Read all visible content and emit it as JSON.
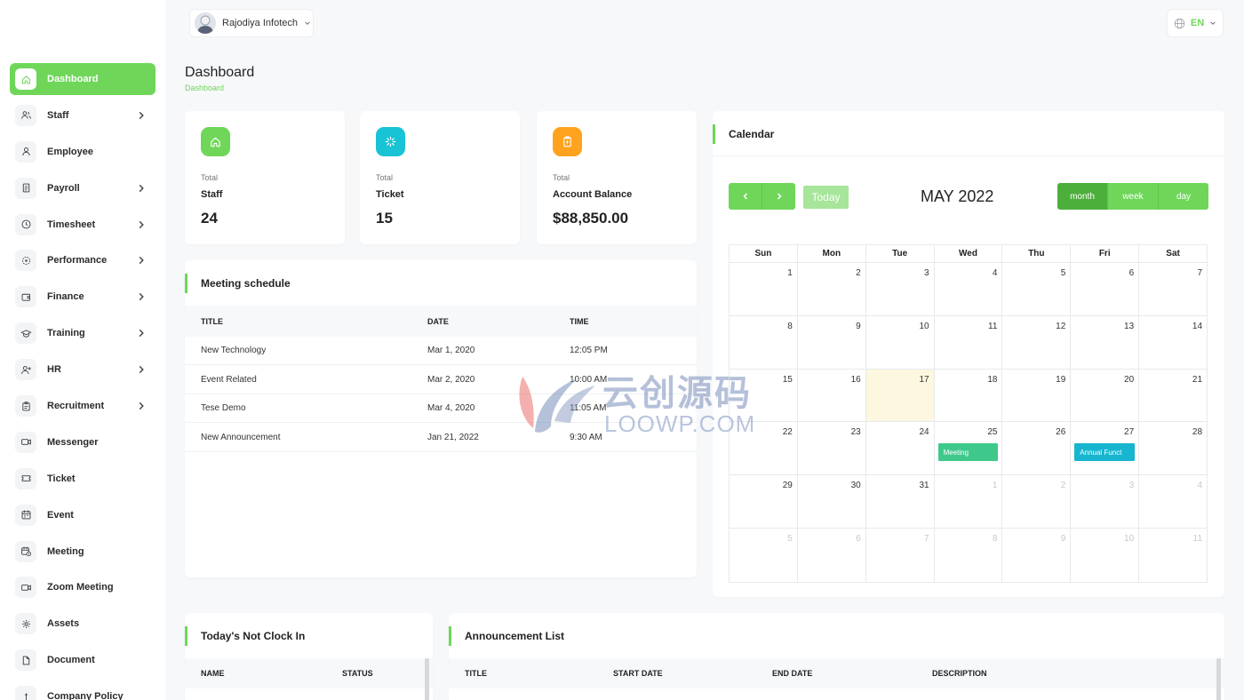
{
  "sidebar": {
    "items": [
      {
        "label": "Dashboard",
        "icon": "home-icon",
        "active": true,
        "chevron": false
      },
      {
        "label": "Staff",
        "icon": "users-icon",
        "chevron": true
      },
      {
        "label": "Employee",
        "icon": "user-icon",
        "chevron": false
      },
      {
        "label": "Payroll",
        "icon": "document-icon",
        "chevron": true
      },
      {
        "label": "Timesheet",
        "icon": "clock-icon",
        "chevron": true
      },
      {
        "label": "Performance",
        "icon": "target-icon",
        "chevron": true
      },
      {
        "label": "Finance",
        "icon": "wallet-icon",
        "chevron": true
      },
      {
        "label": "Training",
        "icon": "graduation-cap-icon",
        "chevron": true
      },
      {
        "label": "HR",
        "icon": "user-plus-icon",
        "chevron": true
      },
      {
        "label": "Recruitment",
        "icon": "clipboard-icon",
        "chevron": true
      },
      {
        "label": "Messenger",
        "icon": "video-icon",
        "chevron": false
      },
      {
        "label": "Ticket",
        "icon": "ticket-icon",
        "chevron": false
      },
      {
        "label": "Event",
        "icon": "calendar-icon",
        "chevron": false
      },
      {
        "label": "Meeting",
        "icon": "calendar-clock-icon",
        "chevron": false
      },
      {
        "label": "Zoom Meeting",
        "icon": "video-icon",
        "chevron": false
      },
      {
        "label": "Assets",
        "icon": "gear-icon",
        "chevron": false
      },
      {
        "label": "Document",
        "icon": "file-icon",
        "chevron": false
      },
      {
        "label": "Company Policy",
        "icon": "policy-icon",
        "chevron": false
      }
    ]
  },
  "header": {
    "user_name": "Rajodiya Infotech",
    "language": "EN"
  },
  "page": {
    "title": "Dashboard",
    "breadcrumb": "Dashboard"
  },
  "stats": [
    {
      "small": "Total",
      "name": "Staff",
      "value": "24",
      "color": "#6fd65a",
      "icon": "home-icon"
    },
    {
      "small": "Total",
      "name": "Ticket",
      "value": "15",
      "color": "#17c3d4",
      "icon": "loader-icon"
    },
    {
      "small": "Total",
      "name": "Account Balance",
      "value": "$88,850.00",
      "color": "#ffa21d",
      "icon": "report-icon"
    }
  ],
  "meetings": {
    "title": "Meeting schedule",
    "headers": [
      "TITLE",
      "DATE",
      "TIME"
    ],
    "rows": [
      [
        "New Technology",
        "Mar 1, 2020",
        "12:05 PM"
      ],
      [
        "Event Related",
        "Mar 2, 2020",
        "10:00 AM"
      ],
      [
        "Tese Demo",
        "Mar 4, 2020",
        "11:05 AM"
      ],
      [
        "New Announcement",
        "Jan 21, 2022",
        "9:30 AM"
      ]
    ]
  },
  "calendar": {
    "title": "Calendar",
    "today_label": "Today",
    "month_title": "MAY 2022",
    "views": [
      "month",
      "week",
      "day"
    ],
    "active_view": "month",
    "dows": [
      "Sun",
      "Mon",
      "Tue",
      "Wed",
      "Thu",
      "Fri",
      "Sat"
    ],
    "weeks": [
      [
        "1",
        "2",
        "3",
        "4",
        "5",
        "6",
        "7"
      ],
      [
        "8",
        "9",
        "10",
        "11",
        "12",
        "13",
        "14"
      ],
      [
        "15",
        "16",
        "17",
        "18",
        "19",
        "20",
        "21"
      ],
      [
        "22",
        "23",
        "24",
        "25",
        "26",
        "27",
        "28"
      ],
      [
        "29",
        "30",
        "31",
        "1",
        "2",
        "3",
        "4"
      ],
      [
        "5",
        "6",
        "7",
        "8",
        "9",
        "10",
        "11"
      ]
    ],
    "today": "17",
    "events": [
      {
        "day": "25",
        "label": "Meeting",
        "color": "#3ec98b"
      },
      {
        "day": "27",
        "label": "Annual Funct",
        "color": "#17b5cf"
      }
    ]
  },
  "not_clock_in": {
    "title": "Today's Not Clock In",
    "headers": [
      "NAME",
      "STATUS"
    ]
  },
  "announcements": {
    "title": "Announcement List",
    "headers": [
      "TITLE",
      "START DATE",
      "END DATE",
      "DESCRIPTION"
    ]
  },
  "watermark": {
    "cn": "云创源码",
    "en": "LOOWP.COM"
  },
  "colors": {
    "accent": "#6fd65a"
  }
}
